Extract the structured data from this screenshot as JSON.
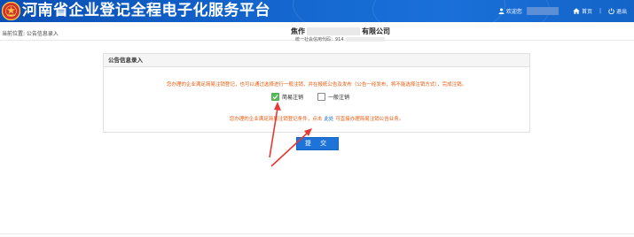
{
  "header": {
    "site_title": "河南省企业登记全程电子化服务平台",
    "nav": {
      "welcome_label": "欢迎您",
      "home_label": "首页",
      "separator": "|",
      "logout_label": "退出"
    }
  },
  "breadcrumb": "当前位置: 公告信息录入",
  "company": {
    "name_start": "焦作",
    "name_end": "有限公司",
    "credit_code_label": "统一社会信用代码：914"
  },
  "panel": {
    "title": "公告信息录入",
    "notice": "您办理的企业满足简易注销登记，也可以通过选择进行一般注销，并在报纸公告及发布（公告一经发布，将不能选择注销方式），完成注销。",
    "options": [
      {
        "label": "简易注销",
        "checked": true
      },
      {
        "label": "一般注销",
        "checked": false
      }
    ],
    "hint_before": "您办理的企业满足简易注销登记条件，点击",
    "hint_link": "此处",
    "hint_after": "可直接办理简易注销公告业务。"
  },
  "submit_label": "提 交",
  "colors": {
    "header_blue": "#1467cf",
    "notice_orange": "#e8590c",
    "link_blue": "#1a6ed8",
    "checkbox_green": "#5cb85c",
    "button_blue": "#1d73d8",
    "annotation_red": "#e53935"
  },
  "icons": {
    "emblem": "national-emblem-icon",
    "user": "user-icon",
    "home": "home-icon",
    "logout": "power-icon",
    "check": "check-icon"
  }
}
